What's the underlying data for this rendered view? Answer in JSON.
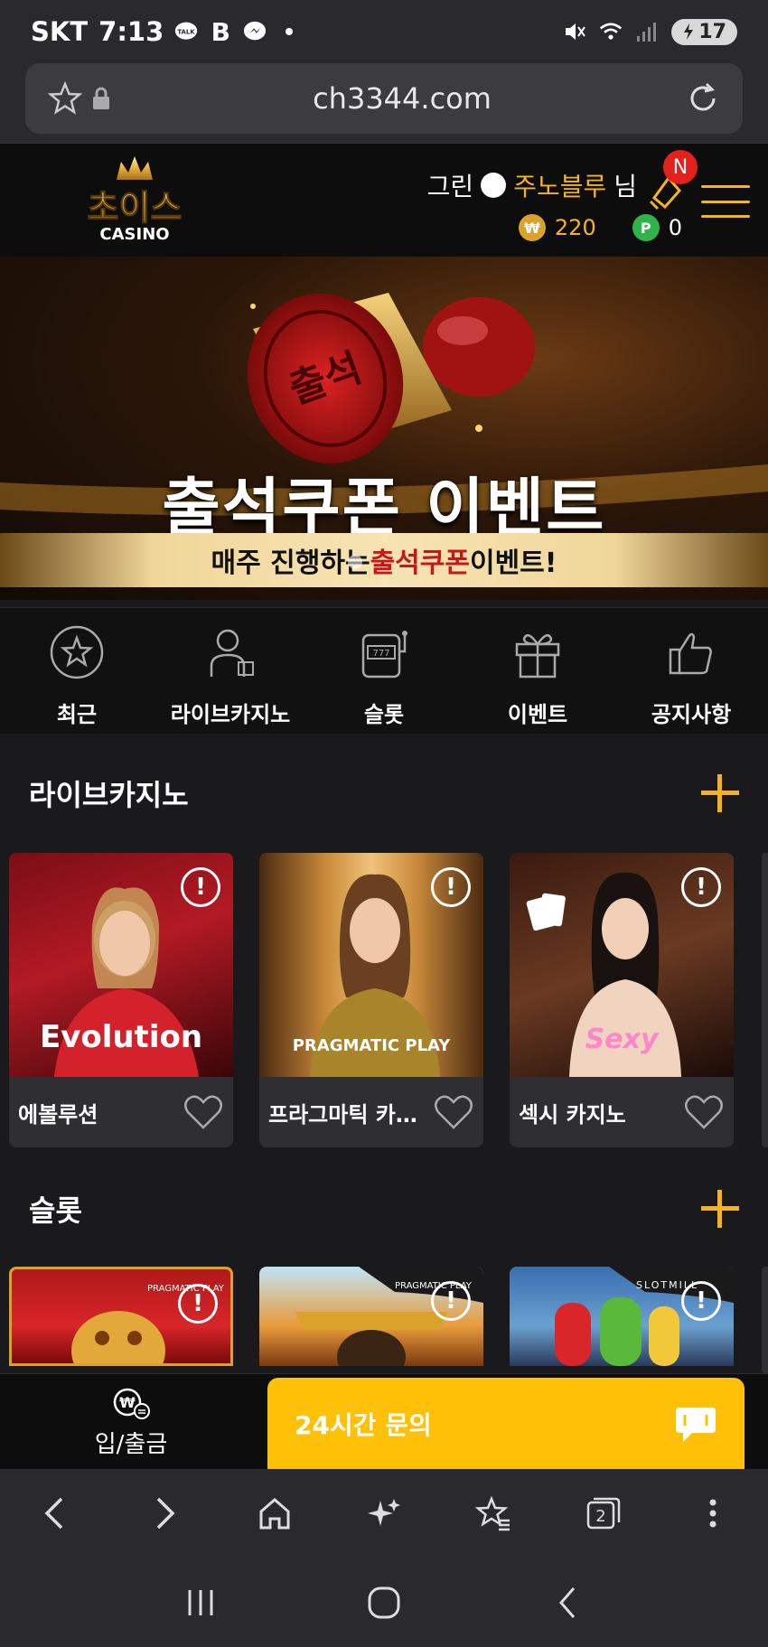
{
  "status_bar": {
    "carrier": "SKT",
    "time": "7:13",
    "talk_badge": "TALK",
    "b_badge": "B",
    "battery": "17",
    "icons": [
      "kakaotalk-icon",
      "band-icon",
      "messenger-icon",
      "dot-icon",
      "mute-icon",
      "wifi-icon",
      "signal-icon",
      "battery-icon"
    ]
  },
  "browser": {
    "url": "ch3344.com"
  },
  "header": {
    "logo_text": "초이스",
    "logo_sub": "CASINO",
    "grade": "그린",
    "username": "주노블루",
    "honorific": "님",
    "money_symbol": "₩",
    "money": "220",
    "point_symbol": "P",
    "points": "0",
    "notification_badge": "N"
  },
  "banner": {
    "stamp_text": "출석",
    "title": "출석쿠폰 이벤트",
    "sub_pre": "매주 진행하는 ",
    "sub_highlight": "출석쿠폰",
    "sub_post": " 이벤트!"
  },
  "categories": [
    {
      "label": "최근",
      "icon": "star-circle-icon"
    },
    {
      "label": "라이브카지노",
      "icon": "dealer-icon"
    },
    {
      "label": "슬롯",
      "icon": "slot-machine-icon"
    },
    {
      "label": "이벤트",
      "icon": "gift-icon"
    },
    {
      "label": "공지사항",
      "icon": "thumbs-up-icon"
    }
  ],
  "live_section": {
    "title": "라이브카지노",
    "cards": [
      {
        "name": "에볼루션",
        "provider": "Evolution"
      },
      {
        "name": "프라그마틱 카지노",
        "provider": "PRAGMATIC PLAY"
      },
      {
        "name": "섹시 카지노",
        "provider": "Sexy"
      }
    ]
  },
  "slot_section": {
    "title": "슬롯",
    "cards": [
      {
        "provider": "PRAGMATIC PLAY"
      },
      {
        "provider": "PRAGMATIC PLAY"
      },
      {
        "provider": "SLOTMILL"
      }
    ]
  },
  "site_bottom": {
    "deposit_label": "입/출금",
    "chat_label": "24시간 문의"
  },
  "browser_toolbar": {
    "tabs_count": "2"
  },
  "colors": {
    "accent": "#f5b324",
    "chat": "#ffc107",
    "badge": "#e3201b"
  }
}
